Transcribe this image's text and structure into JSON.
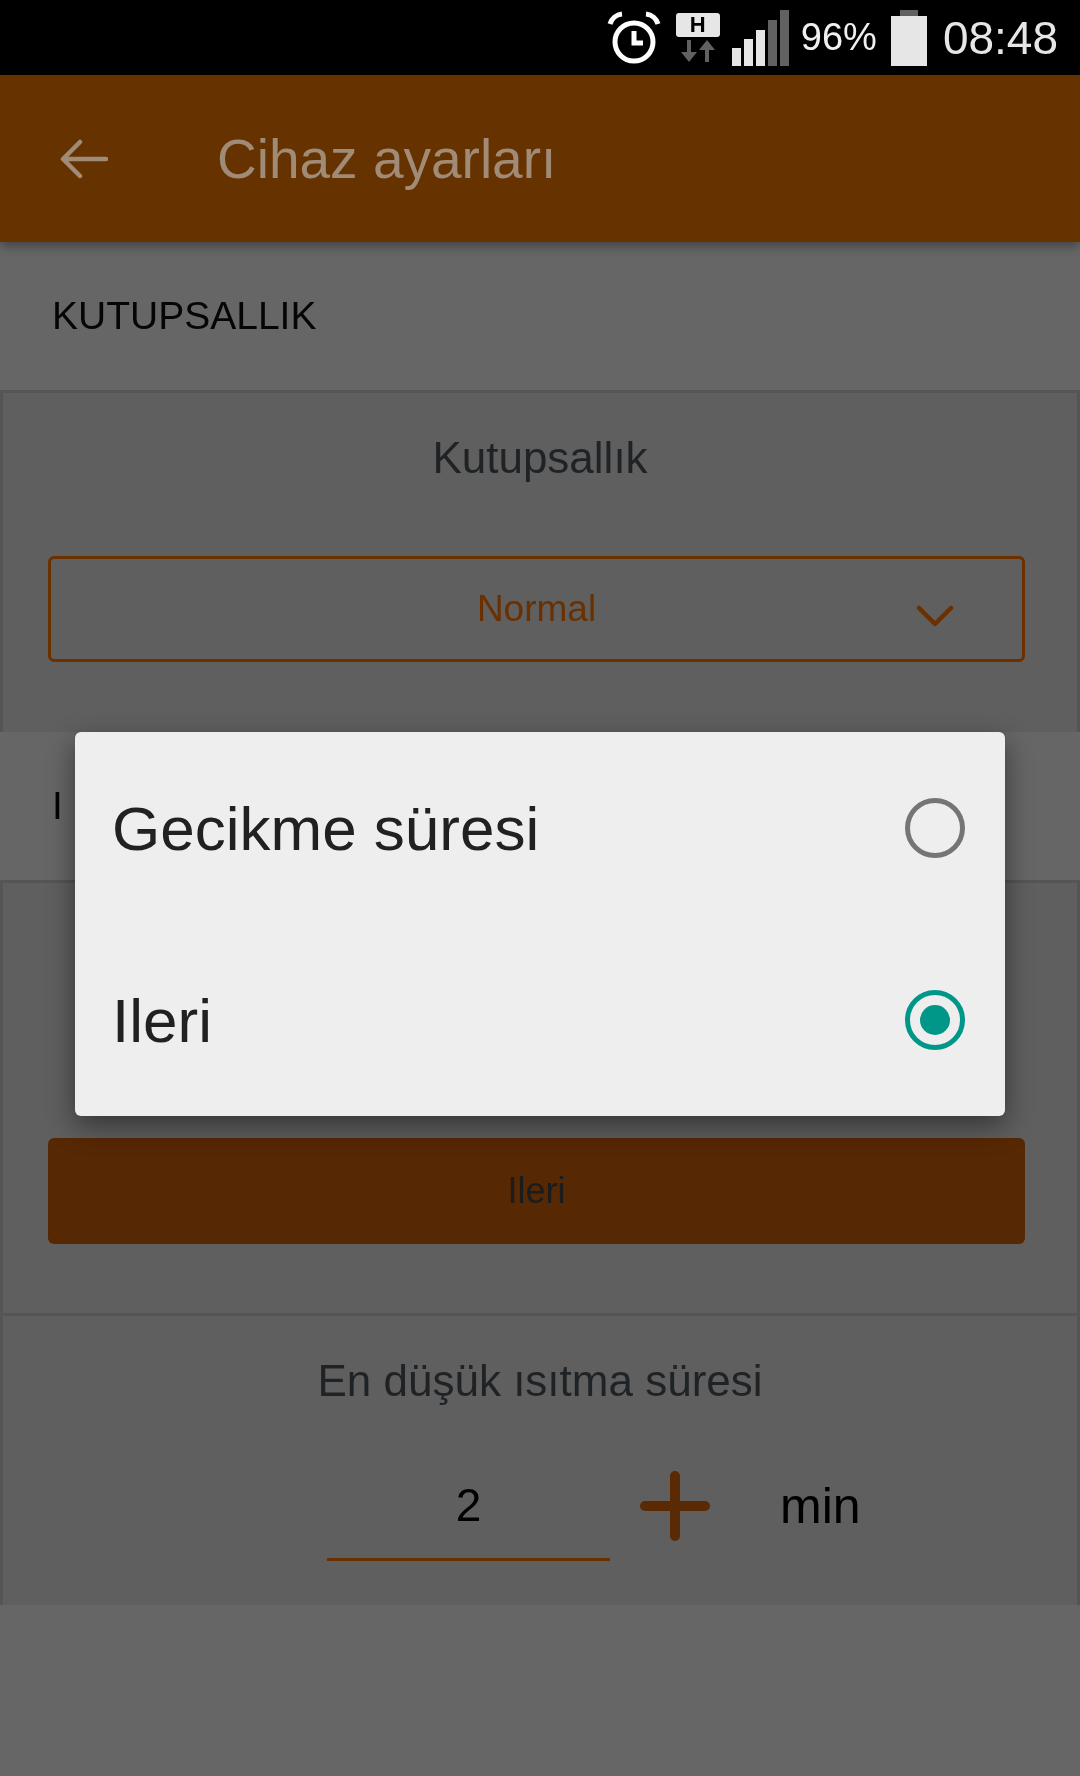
{
  "status_bar": {
    "network_type": "H",
    "battery": "96%",
    "time": "08:48"
  },
  "app_bar": {
    "title": "Cihaz ayarları"
  },
  "sections": [
    {
      "heading": "KUTUPSALLIK",
      "cards": [
        {
          "kind": "dropdown",
          "label": "Kutupsallık",
          "value": "Normal"
        }
      ]
    },
    {
      "heading": "I",
      "cards": [
        {
          "kind": "button",
          "button": "Ileri"
        },
        {
          "kind": "stepper",
          "label": "En düşük ısıtma süresi",
          "value": "2",
          "unit": "min"
        }
      ]
    }
  ],
  "dialog": {
    "options": [
      {
        "label": "Gecikme süresi",
        "selected": false
      },
      {
        "label": "Ileri",
        "selected": true
      }
    ]
  }
}
